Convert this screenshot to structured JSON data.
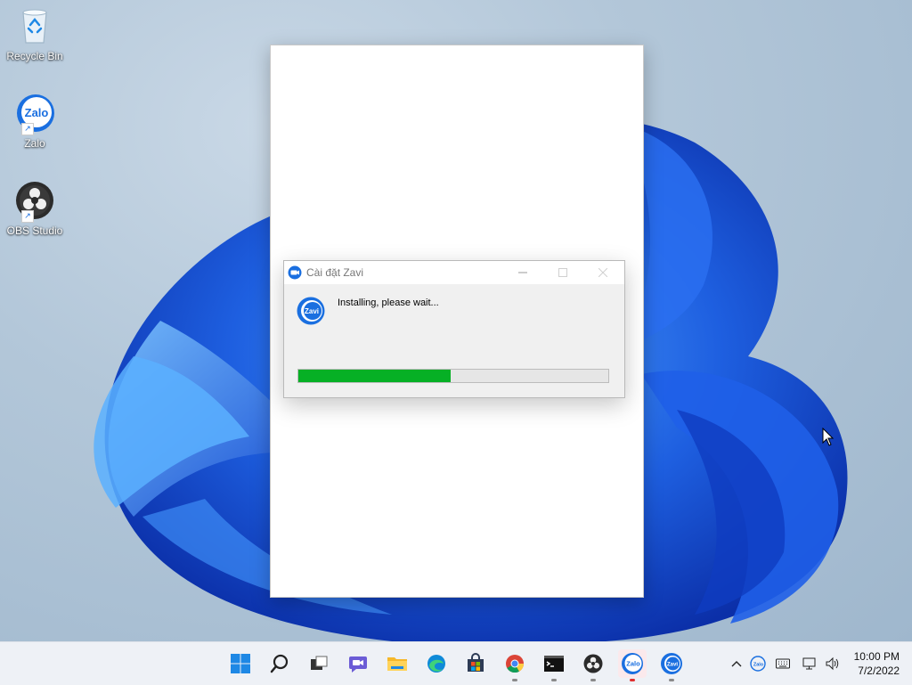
{
  "desktop": {
    "icons": [
      {
        "label": "Recycle Bin",
        "icon": "recycle-bin-icon"
      },
      {
        "label": "Zalo",
        "icon": "zalo-icon"
      },
      {
        "label": "OBS Studio",
        "icon": "obs-studio-icon"
      }
    ]
  },
  "dialog": {
    "title": "Cài đặt Zavi",
    "status": "Installing, please wait...",
    "progress_percent": 49,
    "logo_text": "Zavi"
  },
  "taskbar": {
    "apps": [
      "start-icon",
      "search-icon",
      "task-view-icon",
      "chat-icon",
      "file-explorer-icon",
      "edge-icon",
      "store-icon",
      "chrome-icon",
      "terminal-icon",
      "obs-icon",
      "zalo-icon",
      "zavi-icon"
    ],
    "clock_time": "10:00 PM",
    "clock_date": "7/2/2022",
    "zalo_label": "Zalo",
    "zavi_label": "Zavi",
    "tray_zalo_label": "Zalo"
  },
  "colors": {
    "progress": "#06b025",
    "accent": "#1a6fe0"
  }
}
